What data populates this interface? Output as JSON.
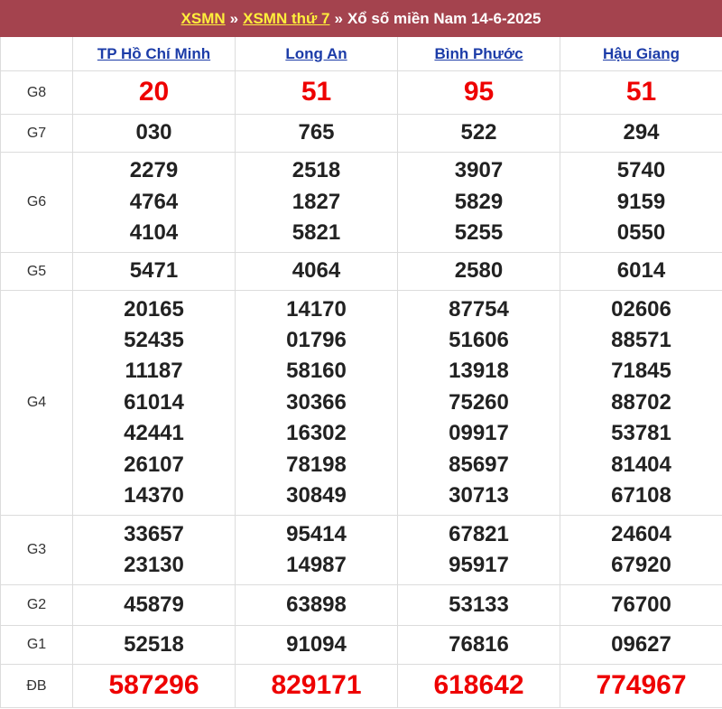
{
  "header": {
    "link1": "XSMN",
    "separator": "»",
    "link2": "XSMN thứ 7",
    "title": "Xổ số miền Nam 14-6-2025"
  },
  "provinces": [
    "TP Hồ Chí Minh",
    "Long An",
    "Bình Phước",
    "Hậu Giang"
  ],
  "prizes": [
    {
      "label": "G8",
      "values": [
        [
          "20"
        ],
        [
          "51"
        ],
        [
          "95"
        ],
        [
          "51"
        ]
      ]
    },
    {
      "label": "G7",
      "values": [
        [
          "030"
        ],
        [
          "765"
        ],
        [
          "522"
        ],
        [
          "294"
        ]
      ]
    },
    {
      "label": "G6",
      "values": [
        [
          "2279",
          "4764",
          "4104"
        ],
        [
          "2518",
          "1827",
          "5821"
        ],
        [
          "3907",
          "5829",
          "5255"
        ],
        [
          "5740",
          "9159",
          "0550"
        ]
      ]
    },
    {
      "label": "G5",
      "values": [
        [
          "5471"
        ],
        [
          "4064"
        ],
        [
          "2580"
        ],
        [
          "6014"
        ]
      ]
    },
    {
      "label": "G4",
      "values": [
        [
          "20165",
          "52435",
          "11187",
          "61014",
          "42441",
          "26107",
          "14370"
        ],
        [
          "14170",
          "01796",
          "58160",
          "30366",
          "16302",
          "78198",
          "30849"
        ],
        [
          "87754",
          "51606",
          "13918",
          "75260",
          "09917",
          "85697",
          "30713"
        ],
        [
          "02606",
          "88571",
          "71845",
          "88702",
          "53781",
          "81404",
          "67108"
        ]
      ]
    },
    {
      "label": "G3",
      "values": [
        [
          "33657",
          "23130"
        ],
        [
          "95414",
          "14987"
        ],
        [
          "67821",
          "95917"
        ],
        [
          "24604",
          "67920"
        ]
      ]
    },
    {
      "label": "G2",
      "values": [
        [
          "45879"
        ],
        [
          "63898"
        ],
        [
          "53133"
        ],
        [
          "76700"
        ]
      ]
    },
    {
      "label": "G1",
      "values": [
        [
          "52518"
        ],
        [
          "91094"
        ],
        [
          "76816"
        ],
        [
          "09627"
        ]
      ]
    },
    {
      "label": "ĐB",
      "values": [
        [
          "587296"
        ],
        [
          "829171"
        ],
        [
          "618642"
        ],
        [
          "774967"
        ]
      ]
    }
  ],
  "colors": {
    "header_bg": "#a4434e",
    "header_link": "#ffef3b",
    "province_link": "#1c3ca8",
    "highlight": "#ee0000"
  }
}
